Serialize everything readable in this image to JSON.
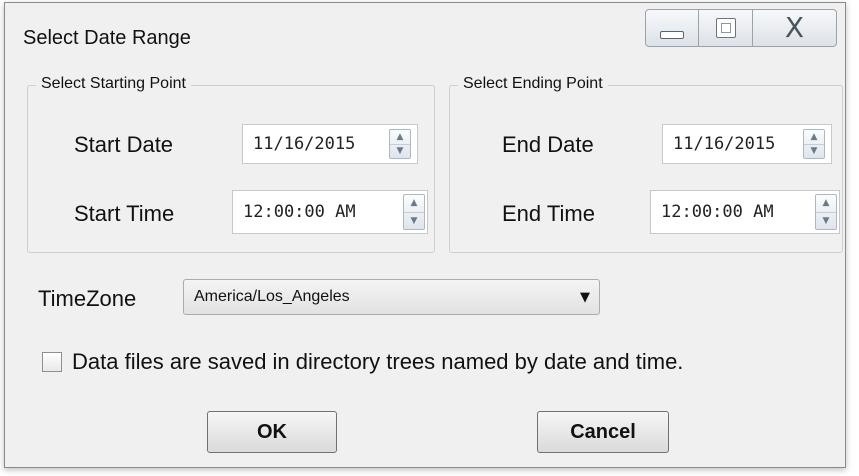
{
  "window": {
    "title": "Select Date Range"
  },
  "caption_buttons": {
    "minimize_icon": "minimize-icon",
    "maximize_icon": "maximize-icon",
    "close_icon": "close-icon",
    "close_glyph": "X"
  },
  "start_group": {
    "title": "Select Starting Point",
    "date_label": "Start Date",
    "date_value": "11/16/2015",
    "time_label": "Start Time",
    "time_value": "12:00:00 AM"
  },
  "end_group": {
    "title": "Select Ending Point",
    "date_label": "End Date",
    "date_value": "11/16/2015",
    "time_label": "End Time",
    "time_value": "12:00:00 AM"
  },
  "timezone": {
    "label": "TimeZone",
    "selected": "America/Los_Angeles"
  },
  "checkbox": {
    "label": "Data files are saved in directory trees named by date and time.",
    "checked": false
  },
  "buttons": {
    "ok": "OK",
    "cancel": "Cancel"
  },
  "glyphs": {
    "up": "▲",
    "down": "▼",
    "caret": "▼"
  }
}
